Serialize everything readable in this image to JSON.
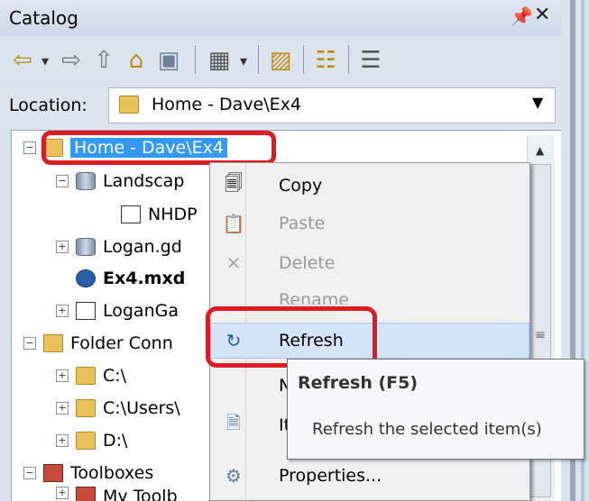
{
  "window": {
    "title": "Catalog",
    "pin_glyph": "⎕",
    "close_glyph": "✕"
  },
  "toolbar": {
    "buttons": [
      {
        "name": "back-icon",
        "glyph": "⇦"
      },
      {
        "name": "dropdown-arrow-icon",
        "glyph": "▾"
      },
      {
        "name": "forward-icon",
        "glyph": "⇨"
      },
      {
        "name": "up-one-level-icon",
        "glyph": "⇧"
      },
      {
        "name": "home-icon",
        "glyph": "⌂"
      },
      {
        "name": "connect-folder-icon",
        "glyph": "▣"
      },
      {
        "name": "views-icon",
        "glyph": "▦"
      },
      {
        "name": "views-dropdown-icon",
        "glyph": "▾"
      },
      {
        "name": "new-folder-icon",
        "glyph": "▨"
      },
      {
        "name": "catalog-tree-icon",
        "glyph": "☷"
      },
      {
        "name": "options-icon",
        "glyph": "☰"
      }
    ]
  },
  "location": {
    "label": "Location:",
    "value": "Home - Dave\\Ex4"
  },
  "tree": {
    "items": [
      {
        "label": "Home - Dave\\Ex4",
        "expander": "−",
        "icon": "folder-home-icon",
        "selected": true
      },
      {
        "label": "Landscap",
        "expander": "−",
        "icon": "geodatabase-icon"
      },
      {
        "label": "NHDP",
        "expander": "",
        "icon": "feature-class-icon"
      },
      {
        "label": "Logan.gd",
        "expander": "+",
        "icon": "geodatabase-icon"
      },
      {
        "label": "Ex4.mxd",
        "expander": "",
        "icon": "map-document-icon",
        "bold": true
      },
      {
        "label": "LoganGa",
        "expander": "+",
        "icon": "toolbox-file-icon"
      },
      {
        "label": "Folder Conn",
        "expander": "−",
        "icon": "folder-connections-icon"
      },
      {
        "label": "C:\\",
        "expander": "+",
        "icon": "folder-icon"
      },
      {
        "label": "C:\\Users\\",
        "expander": "+",
        "icon": "folder-icon"
      },
      {
        "label": "D:\\",
        "expander": "+",
        "icon": "folder-icon"
      },
      {
        "label": "Toolboxes",
        "expander": "−",
        "icon": "toolboxes-icon"
      },
      {
        "label": "My Toolb",
        "expander": "+",
        "icon": "toolbox-icon"
      }
    ]
  },
  "context_menu": {
    "items": [
      {
        "label": "Copy",
        "icon": "copy-icon",
        "enabled": true
      },
      {
        "label": "Paste",
        "icon": "paste-icon",
        "enabled": false
      },
      {
        "label": "Delete",
        "icon": "delete-icon",
        "enabled": false
      },
      {
        "label": "Rename",
        "icon": "",
        "enabled": false
      },
      {
        "label": "Refresh",
        "icon": "refresh-icon",
        "enabled": true,
        "highlighted": true
      },
      {
        "label": "N",
        "icon": "",
        "enabled": true
      },
      {
        "label": "It",
        "icon": "item-description-icon",
        "enabled": true
      },
      {
        "label": "Properties...",
        "icon": "properties-icon",
        "enabled": true
      }
    ]
  },
  "tooltip": {
    "title": "Refresh (F5)",
    "body": "Refresh the selected item(s)"
  },
  "scrollbar": {
    "grip_glyph": "≡",
    "up_glyph": "▲"
  }
}
